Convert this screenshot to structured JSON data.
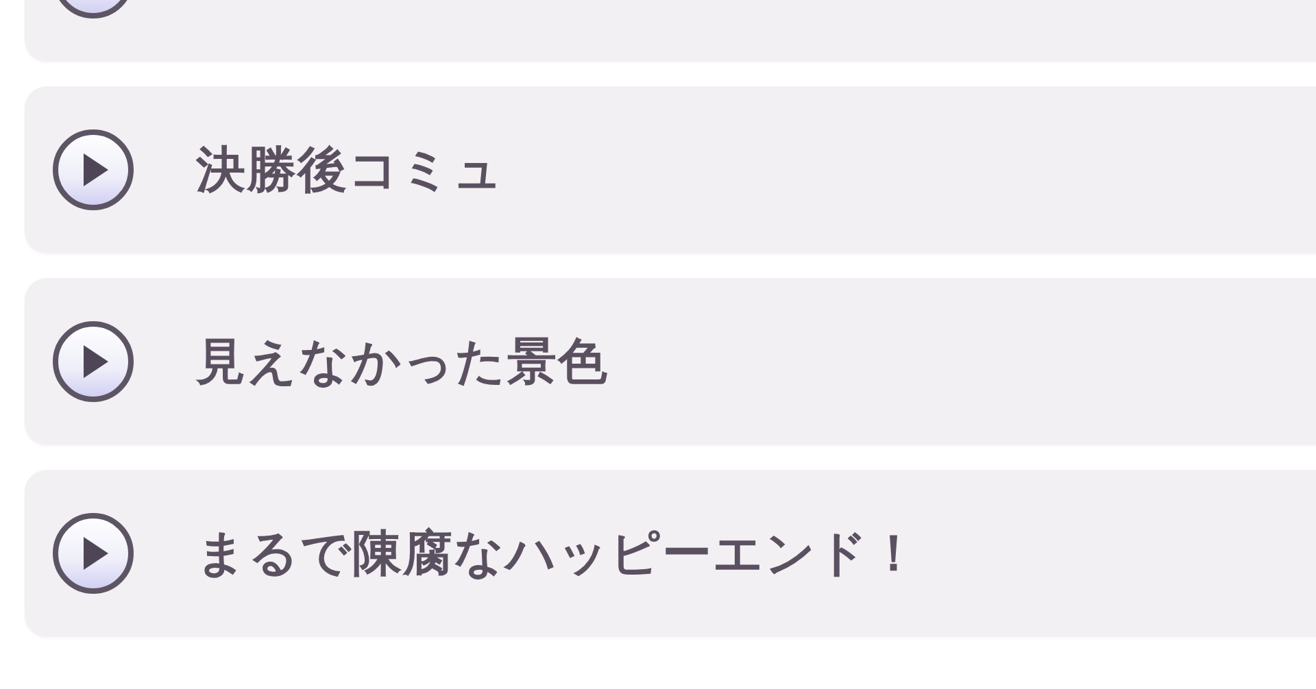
{
  "story_list": [
    {
      "partial": true
    },
    {
      "title": "決勝後コミュ"
    },
    {
      "title": "見えなかった景色"
    },
    {
      "title": "まるで陳腐なハッピーエンド！"
    }
  ]
}
